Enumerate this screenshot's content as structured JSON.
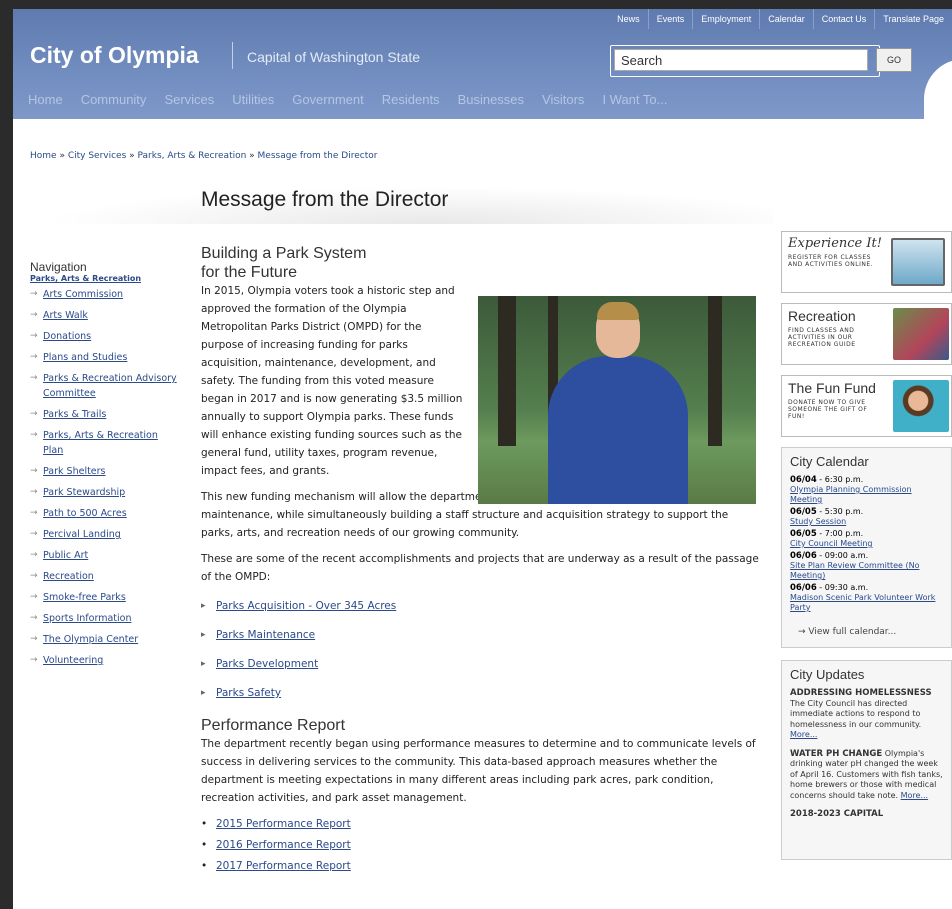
{
  "utility_nav": [
    "News",
    "Events",
    "Employment",
    "Calendar",
    "Contact Us",
    "Translate Page"
  ],
  "site": {
    "name": "City of Olympia",
    "tagline": "Capital of Washington State"
  },
  "search": {
    "placeholder": "Search",
    "go_label": "GO"
  },
  "main_nav": [
    "Home",
    "Community",
    "Services",
    "Utilities",
    "Government",
    "Residents",
    "Businesses",
    "Visitors",
    "I Want To..."
  ],
  "breadcrumb": [
    "Home",
    "City Services",
    "Parks, Arts & Recreation",
    "Message from the Director"
  ],
  "page_title": "Message from the Director",
  "leftnav": {
    "heading": "Navigation",
    "section": "Parks, Arts & Recreation",
    "items": [
      "Arts Commission",
      "Arts Walk",
      "Donations",
      "Plans and Studies",
      "Parks & Recreation Advisory Committee",
      "Parks & Trails",
      "Parks, Arts & Recreation Plan",
      "Park Shelters",
      "Park Stewardship",
      "Path to 500 Acres",
      "Percival Landing",
      "Public Art",
      "Recreation",
      "Smoke-free Parks",
      "Sports Information",
      "The Olympia Center",
      "Volunteering"
    ]
  },
  "content": {
    "h1_line1": "Building a Park System",
    "h1_line2": "for the Future",
    "p1": "In 2015, Olympia voters took a historic step and approved the formation of the Olympia Metropolitan Parks District (OMPD) for the purpose of increasing funding for parks acquisition, maintenance, development, and safety. The funding from this voted measure began in 2017 and is now generating $3.5 million annually to support Olympia parks. These funds will enhance existing funding sources such as the general fund, utility taxes, program revenue, impact fees, and grants.",
    "p2": "This new funding mechanism will allow the department to catch up on several years of deferred maintenance, while simultaneously building a staff structure and acquisition strategy to support the parks, arts, and recreation needs of our growing community.",
    "p3": "These are some of the recent accomplishments and projects that are underway as a result of the passage of the OMPD:",
    "links": [
      "Parks Acquisition - Over 345 Acres",
      "Parks Maintenance",
      "Parks Development",
      "Parks Safety"
    ],
    "h2": "Performance Report",
    "p4": "The department recently began using performance measures to determine and to communicate levels of success in delivering services to the community. This data-based approach measures whether the department is meeting expectations in many different areas including park acres, park condition, recreation activities, and park asset management.",
    "reports": [
      "2015 Performance Report",
      "2016 Performance Report",
      "2017 Performance Report"
    ]
  },
  "sidebar": {
    "promo1": {
      "heading": "Experience It!",
      "text": "Register for classes and activities online."
    },
    "promo2": {
      "heading": "Recreation",
      "text": "Find classes and activities in our recreation guide"
    },
    "promo3": {
      "heading": "The Fun Fund",
      "text": "Donate now to give someone the gift of fun!"
    },
    "calendar_title": "City Calendar",
    "events": [
      {
        "date": "06/04",
        "time": "6:30 p.m.",
        "title": "Olympia Planning Commission Meeting"
      },
      {
        "date": "06/05",
        "time": "5:30 p.m.",
        "title": "Study Session"
      },
      {
        "date": "06/05",
        "time": "7:00 p.m.",
        "title": "City Council Meeting"
      },
      {
        "date": "06/06",
        "time": "09:00 a.m.",
        "title": "Site Plan Review Committee (No Meeting)"
      },
      {
        "date": "06/06",
        "time": "09:30 a.m.",
        "title": "Madison Scenic Park Volunteer Work Party"
      }
    ],
    "view_all": "View full calendar...",
    "updates_title": "City Updates",
    "updates": [
      {
        "title": "Addressing Homelessness",
        "text": "The City Council has directed immediate actions to respond to homelessness in our community.",
        "more": "More..."
      },
      {
        "title": "Water pH Change",
        "text": "Olympia's drinking water pH changed the week of April 16. Customers with fish tanks, home brewers or those with medical concerns should take note.",
        "more": "More..."
      },
      {
        "title": "2018-2023 Capital",
        "text": "",
        "more": ""
      }
    ]
  }
}
